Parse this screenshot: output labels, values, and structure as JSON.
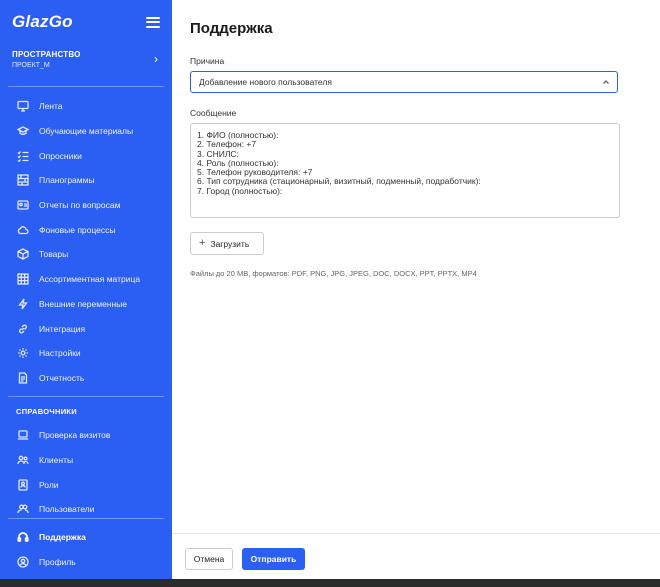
{
  "sidebar": {
    "logo": "GlazGo",
    "space": {
      "title": "ПРОСТРАНСТВО",
      "project": "ПРОЕКТ_М"
    },
    "items": [
      {
        "label": "Лента",
        "icon": "monitor-icon"
      },
      {
        "label": "Обучающие материалы",
        "icon": "graduation-cap-icon"
      },
      {
        "label": "Опросники",
        "icon": "checklist-icon"
      },
      {
        "label": "Планограммы",
        "icon": "shelves-icon"
      },
      {
        "label": "Отчеты по вопросам",
        "icon": "report-id-icon"
      },
      {
        "label": "Фоновые процессы",
        "icon": "cloud-icon"
      },
      {
        "label": "Товары",
        "icon": "box-icon"
      },
      {
        "label": "Ассортиментная матрица",
        "icon": "grid-table-icon"
      },
      {
        "label": "Внешние переменные",
        "icon": "lightning-icon"
      },
      {
        "label": "Интеграция",
        "icon": "link-icon"
      },
      {
        "label": "Настройки",
        "icon": "gear-icon"
      },
      {
        "label": "Отчетность",
        "icon": "document-icon"
      }
    ],
    "section_title": "СПРАВОЧНИКИ",
    "reference_items": [
      {
        "label": "Проверка визитов",
        "icon": "laptop-icon"
      },
      {
        "label": "Клиенты",
        "icon": "users-icon"
      },
      {
        "label": "Роли",
        "icon": "role-card-icon"
      },
      {
        "label": "Пользователи",
        "icon": "people-icon"
      }
    ],
    "bottom_items": [
      {
        "label": "Поддержка",
        "icon": "headset-icon",
        "active": true
      },
      {
        "label": "Профиль",
        "icon": "user-circle-icon"
      }
    ]
  },
  "main": {
    "title": "Поддержка",
    "reason_label": "Причина",
    "reason_value": "Добавление нового пользователя",
    "message_label": "Сообщение",
    "message_text": "1. ФИО (полностью):\n2. Телефон: +7\n3. СНИЛС:\n4. Роль (полностью):\n5. Телефон руководителя: +7\n6. Тип сотрудника (стационарный, визитный, подменный, подработчик):\n7. Город (полностью):",
    "upload_label": "Загрузить",
    "hint": "Файлы до 20 MB, форматов: PDF, PNG, JPG, JPEG, DOC, DOCX, PPT, PPTX, MP4",
    "cancel_label": "Отмена",
    "submit_label": "Отправить"
  },
  "colors": {
    "accent": "#2b5ef2"
  }
}
